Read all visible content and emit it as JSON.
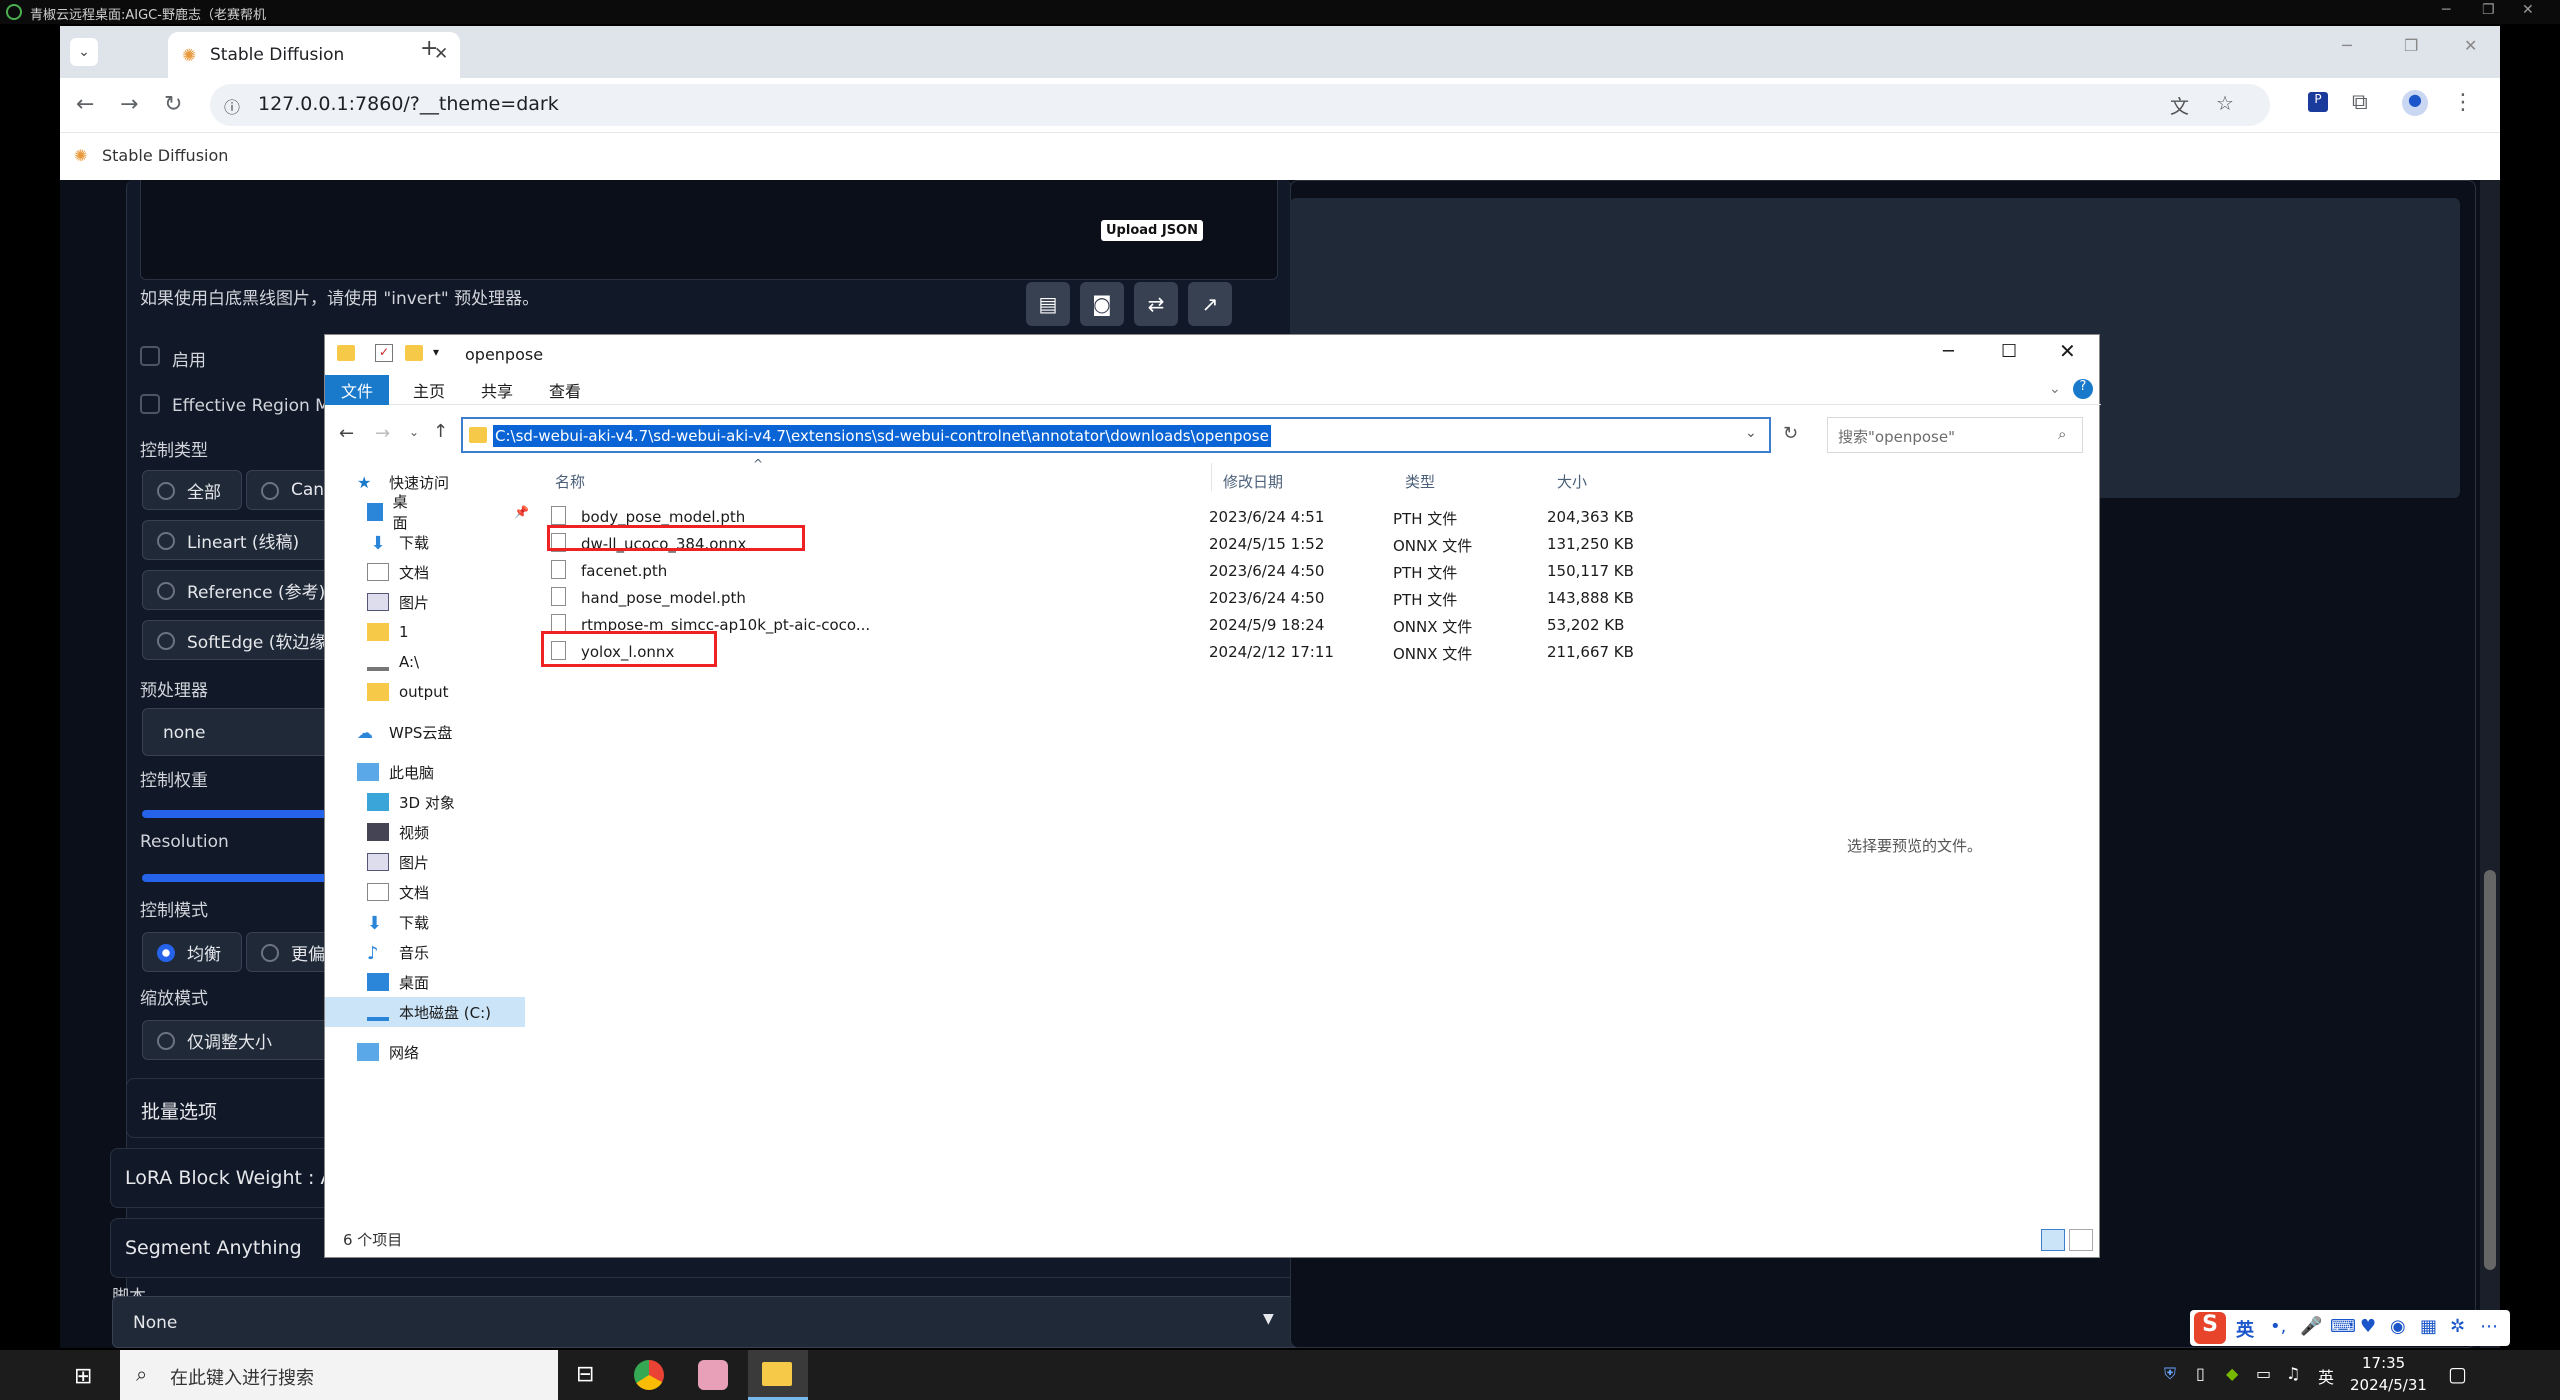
{
  "remote": {
    "title": "青椒云远程桌面:AIGC-野鹿志（老赛帮机"
  },
  "browser": {
    "tab_title": "Stable Diffusion",
    "url": "127.0.0.1:7860/?__theme=dark",
    "bookmark": "Stable Diffusion"
  },
  "webui": {
    "upload_json": "Upload JSON",
    "invert_hint": "如果使用白底黑线图片，请使用 \"invert\" 预处理器。",
    "enable": "启用",
    "effective_region": "Effective Region Mas",
    "control_type": "控制类型",
    "type_all": "全部",
    "type_canny": "Cann",
    "type_lineart": "Lineart (线稿)",
    "type_reference": "Reference (参考)",
    "type_softedge": "SoftEdge (软边缘)",
    "preprocessor": "预处理器",
    "preprocessor_value": "none",
    "control_weight": "控制权重",
    "resolution": "Resolution",
    "control_mode": "控制模式",
    "mode_balanced": "均衡",
    "mode_more": "更偏",
    "resize_mode": "缩放模式",
    "resize_only": "仅调整大小",
    "batch_options": "批量选项",
    "lora_block": "LoRA Block Weight : Acti",
    "segment_anything": "Segment Anything",
    "script": "脚本",
    "script_value": "None"
  },
  "explorer": {
    "title": "openpose",
    "ribbon_tabs": [
      "文件",
      "主页",
      "共享",
      "查看"
    ],
    "address": "C:\\sd-webui-aki-v4.7\\sd-webui-aki-v4.7\\extensions\\sd-webui-controlnet\\annotator\\downloads\\openpose",
    "search_placeholder": "搜索\"openpose\"",
    "nav": {
      "quick_access": "快速访问",
      "qa_items": [
        "桌面",
        "下载",
        "文档",
        "图片",
        "1",
        "A:\\",
        "output"
      ],
      "wps": "WPS云盘",
      "this_pc": "此电脑",
      "pc_items": [
        "3D 对象",
        "视频",
        "图片",
        "文档",
        "下载",
        "音乐",
        "桌面",
        "本地磁盘 (C:)"
      ],
      "network": "网络"
    },
    "columns": {
      "name": "名称",
      "date": "修改日期",
      "type": "类型",
      "size": "大小"
    },
    "files": [
      {
        "name": "body_pose_model.pth",
        "date": "2023/6/24 4:51",
        "type": "PTH 文件",
        "size": "204,363 KB"
      },
      {
        "name": "dw-ll_ucoco_384.onnx",
        "date": "2024/5/15 1:52",
        "type": "ONNX 文件",
        "size": "131,250 KB"
      },
      {
        "name": "facenet.pth",
        "date": "2023/6/24 4:50",
        "type": "PTH 文件",
        "size": "150,117 KB"
      },
      {
        "name": "hand_pose_model.pth",
        "date": "2023/6/24 4:50",
        "type": "PTH 文件",
        "size": "143,888 KB"
      },
      {
        "name": "rtmpose-m_simcc-ap10k_pt-aic-coco...",
        "date": "2024/5/9 18:24",
        "type": "ONNX 文件",
        "size": "53,202 KB"
      },
      {
        "name": "yolox_l.onnx",
        "date": "2024/2/12 17:11",
        "type": "ONNX 文件",
        "size": "211,667 KB"
      }
    ],
    "preview_hint": "选择要预览的文件。",
    "status": "6 个项目"
  },
  "taskbar": {
    "search_placeholder": "在此键入进行搜索",
    "ime": "英",
    "time": "17:35",
    "date": "2024/5/31",
    "ime2": "英"
  }
}
